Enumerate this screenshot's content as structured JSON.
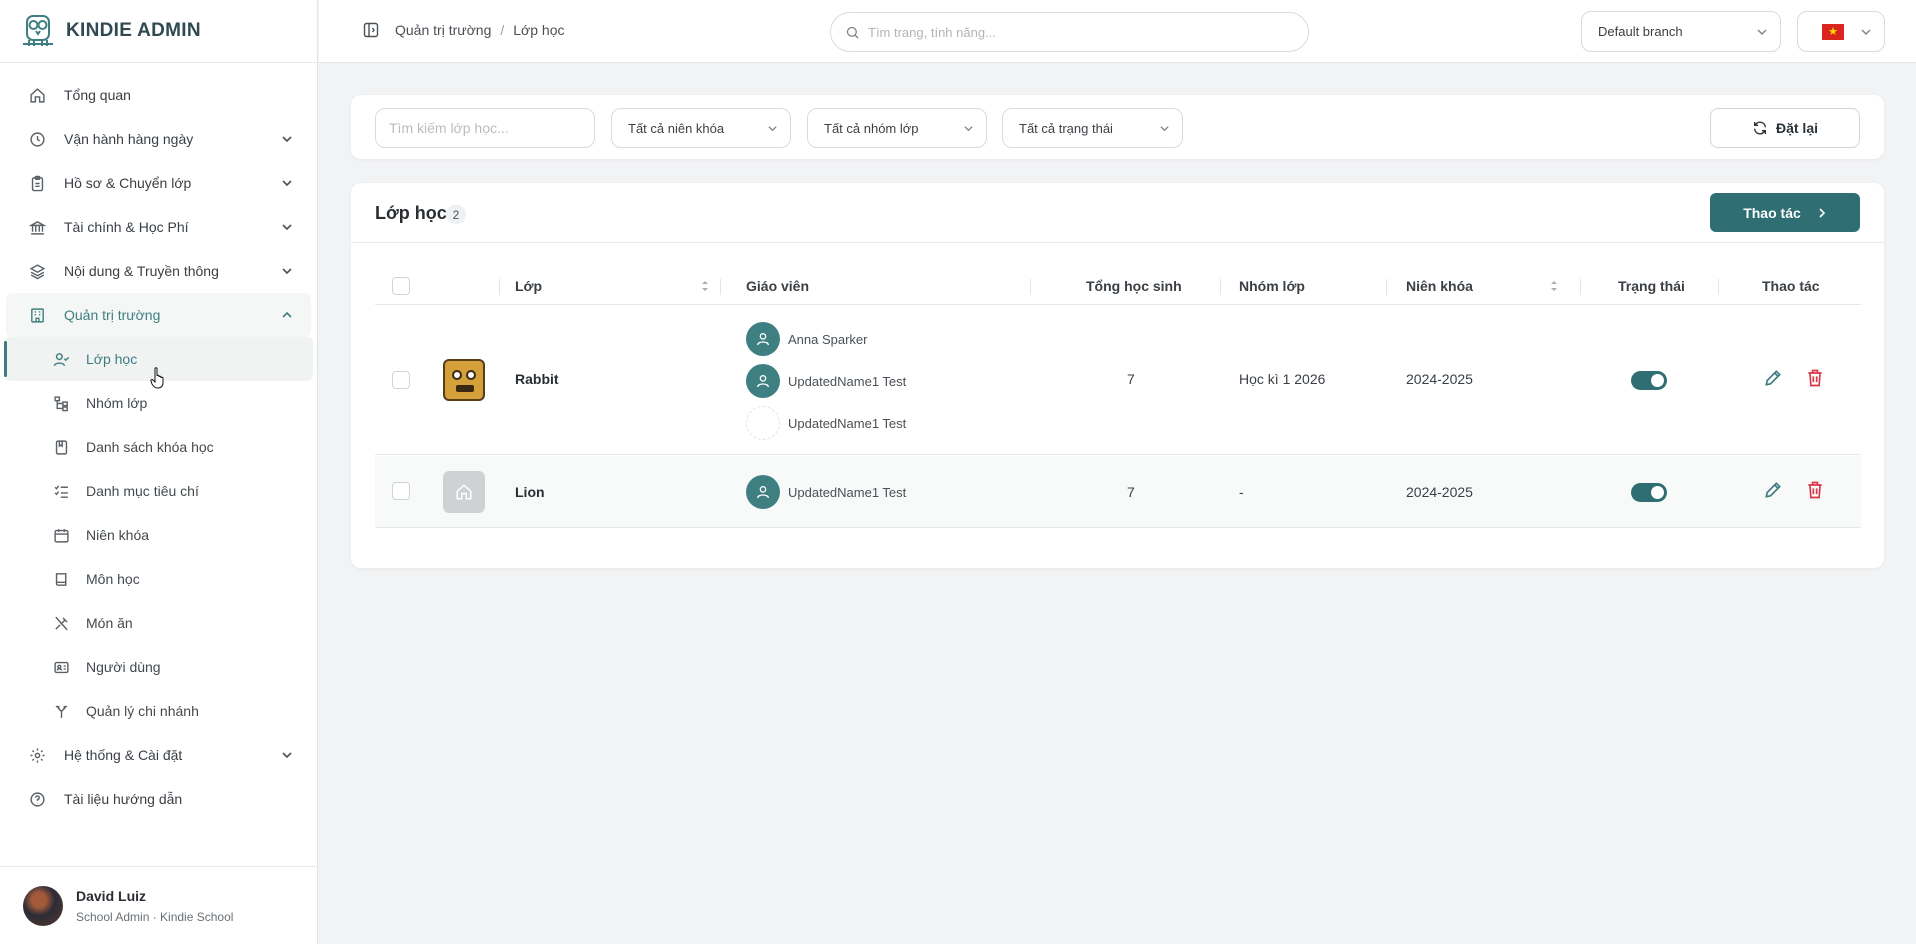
{
  "brand": {
    "name": "KINDIE ADMIN"
  },
  "sidebar": {
    "items": [
      {
        "label": "Tổng quan",
        "icon": "home-icon"
      },
      {
        "label": "Vận hành hàng ngày",
        "icon": "clock-icon"
      },
      {
        "label": "Hồ sơ & Chuyển lớp",
        "icon": "clipboard-icon"
      },
      {
        "label": "Tài chính & Học Phí",
        "icon": "bank-icon"
      },
      {
        "label": "Nội dung & Truyền thông",
        "icon": "layers-icon"
      },
      {
        "label": "Quản trị trường",
        "icon": "building-icon"
      }
    ],
    "sub_items": [
      {
        "label": "Lớp học",
        "icon": "user-check-icon"
      },
      {
        "label": "Nhóm lớp",
        "icon": "hierarchy-icon"
      },
      {
        "label": "Danh sách khóa học",
        "icon": "bookmark-book-icon"
      },
      {
        "label": "Danh mục tiêu chí",
        "icon": "checklist-icon"
      },
      {
        "label": "Niên khóa",
        "icon": "calendar-icon"
      },
      {
        "label": "Môn học",
        "icon": "book-icon"
      },
      {
        "label": "Món ăn",
        "icon": "utensils-icon"
      },
      {
        "label": "Người dùng",
        "icon": "id-card-icon"
      },
      {
        "label": "Quản lý chi nhánh",
        "icon": "branch-icon"
      }
    ],
    "bottom_items": [
      {
        "label": "Hệ thống & Cài đặt",
        "icon": "gear-icon"
      },
      {
        "label": "Tài liệu hướng dẫn",
        "icon": "help-circle-icon"
      }
    ]
  },
  "user": {
    "name": "David Luiz",
    "role": "School Admin · Kindie School"
  },
  "header": {
    "breadcrumb": [
      "Quản trị trường",
      "Lớp học"
    ],
    "breadcrumb_sep": "/",
    "search_placeholder": "Tìm trang, tính năng...",
    "branch": "Default branch",
    "flag_star": "★"
  },
  "filters": {
    "search_placeholder": "Tìm kiếm lớp học...",
    "year": "Tất cả niên khóa",
    "group": "Tất cả nhóm lớp",
    "status": "Tất cả trạng thái",
    "reset": "Đặt lại"
  },
  "table": {
    "title": "Lớp học",
    "count": "2",
    "action_label": "Thao tác",
    "columns": {
      "class": "Lớp",
      "teacher": "Giáo viên",
      "students": "Tổng học sinh",
      "group": "Nhóm lớp",
      "year": "Niên khóa",
      "status": "Trạng thái",
      "actions": "Thao tác"
    },
    "rows": [
      {
        "name": "Rabbit",
        "teachers": [
          "Anna Sparker",
          "UpdatedName1 Test",
          "UpdatedName1 Test"
        ],
        "students": "7",
        "group": "Học kì 1 2026",
        "year": "2024-2025",
        "active": true
      },
      {
        "name": "Lion",
        "teachers": [
          "UpdatedName1 Test"
        ],
        "students": "7",
        "group": "-",
        "year": "2024-2025",
        "active": true
      }
    ]
  },
  "colors": {
    "accent": "#2f6f73",
    "danger": "#d9364a",
    "active_text": "#3f7f82"
  }
}
